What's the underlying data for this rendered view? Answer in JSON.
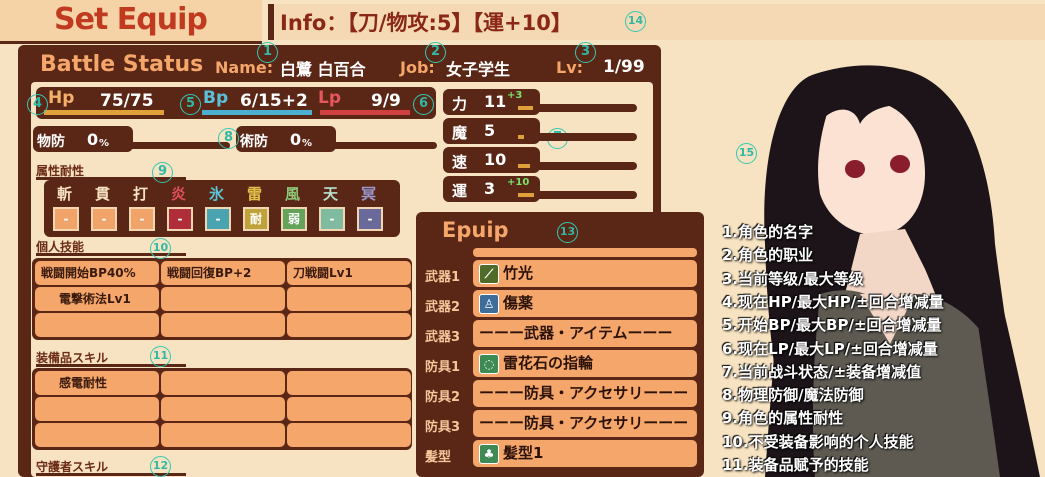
{
  "header": {
    "title": "Set Equip",
    "info": "Info：【刀/物攻:5】【運+10】"
  },
  "status": {
    "heading": "Battle Status",
    "name_label": "Name:",
    "name": "白鷺 白百合",
    "job_label": "Job:",
    "job": "女子学生",
    "lv_label": "Lv:",
    "lv": "1/99",
    "hp_label": "Hp",
    "hp": "75/75",
    "bp_label": "Bp",
    "bp": "6/15+2",
    "lp_label": "Lp",
    "lp": "9/9",
    "pdef_label": "物防",
    "pdef": "0",
    "mdef_label": "術防",
    "mdef": "0",
    "pct": "%"
  },
  "attributes": {
    "title": "属性耐性",
    "elements": [
      {
        "name": "斬",
        "value": "-",
        "color": "#f0a46a",
        "text": "#f7e3c1"
      },
      {
        "name": "貫",
        "value": "-",
        "color": "#f0a46a",
        "text": "#f7e3c1"
      },
      {
        "name": "打",
        "value": "-",
        "color": "#f0a46a",
        "text": "#f7e3c1"
      },
      {
        "name": "炎",
        "value": "-",
        "color": "#b02d3a",
        "text": "#e0505a"
      },
      {
        "name": "氷",
        "value": "-",
        "color": "#4aa3b0",
        "text": "#58c7d8"
      },
      {
        "name": "雷",
        "value": "耐",
        "color": "#c0a23a",
        "text": "#e2c24a"
      },
      {
        "name": "風",
        "value": "弱",
        "color": "#63a35a",
        "text": "#8ec878"
      },
      {
        "name": "天",
        "value": "-",
        "color": "#7fbba0",
        "text": "#b5e1cc"
      },
      {
        "name": "冥",
        "value": "-",
        "color": "#6a6a9a",
        "text": "#9a9ad0"
      }
    ]
  },
  "stats": [
    {
      "label": "力",
      "value": "11",
      "bonus": "+3",
      "fill": 0.12
    },
    {
      "label": "魔",
      "value": "5",
      "bonus": "",
      "fill": 0.05
    },
    {
      "label": "速",
      "value": "10",
      "bonus": "",
      "fill": 0.1
    },
    {
      "label": "運",
      "value": "3",
      "bonus": "+10",
      "fill": 0.13
    }
  ],
  "personal_skills": {
    "title": "個人技能",
    "cells": [
      "戦闘開始BP40%",
      "戦闘回復BP+2",
      "刀戦闘Lv1",
      "電撃術法Lv1",
      "",
      "",
      "",
      "",
      ""
    ]
  },
  "equip_skills": {
    "title": "装備品スキル",
    "cells": [
      "感電耐性",
      "",
      "",
      "",
      "",
      "",
      "",
      "",
      ""
    ]
  },
  "guardian_skills": {
    "title": "守護者スキル"
  },
  "equip": {
    "heading": "Epuip",
    "slots": [
      {
        "label": "武器1",
        "icon": "sword-icon",
        "glyph": "⟋",
        "bg": "#4f6b2a",
        "name": "竹光"
      },
      {
        "label": "武器2",
        "icon": "potion-icon",
        "glyph": "♙",
        "bg": "#3d6d9b",
        "name": "傷薬"
      },
      {
        "label": "武器3",
        "icon": "",
        "glyph": "",
        "bg": "",
        "name": "ーーー武器・アイテムーーー"
      },
      {
        "label": "防具1",
        "icon": "ring-icon",
        "glyph": "◌",
        "bg": "#3e8a55",
        "name": "雷花石の指輪"
      },
      {
        "label": "防具2",
        "icon": "",
        "glyph": "",
        "bg": "",
        "name": "ーーー防具・アクセサリーーー"
      },
      {
        "label": "防具3",
        "icon": "",
        "glyph": "",
        "bg": "",
        "name": "ーーー防具・アクセサリーーー"
      },
      {
        "label": "髪型",
        "icon": "hair-icon",
        "glyph": "♣",
        "bg": "#3e8a55",
        "name": "髪型1"
      }
    ]
  },
  "legend": [
    "1.角色的名字",
    "2.角色的职业",
    "3.当前等级/最大等级",
    "4.现在HP/最大HP/±回合增减量",
    "5.开始BP/最大BP/±回合增减量",
    "6.现在LP/最大LP/±回合增减量",
    "7.当前战斗状态/±装备增减值",
    "8.物理防御/魔法防御",
    "9.角色的属性耐性",
    "10.不受装备影响的个人技能",
    "11.装备品赋予的技能"
  ],
  "markers": [
    "1",
    "2",
    "3",
    "4",
    "5",
    "6",
    "7",
    "8",
    "9",
    "10",
    "11",
    "12",
    "13",
    "14",
    "15"
  ]
}
